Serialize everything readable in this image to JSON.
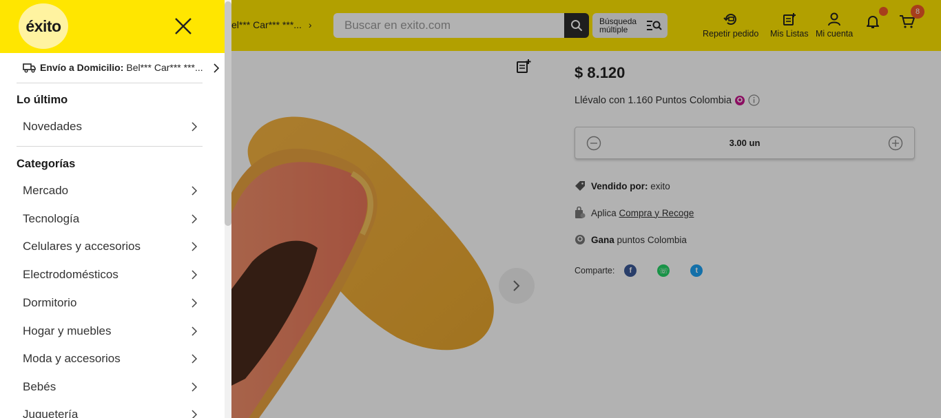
{
  "header": {
    "address_short": "el*** Car*** ***...",
    "search_placeholder": "Buscar en exito.com",
    "multi_search_label": "Búsqueda múltiple",
    "actions": {
      "repeat_order": "Repetir pedido",
      "my_lists": "Mis Listas",
      "my_account": "Mi cuenta"
    },
    "cart_count": "8"
  },
  "product": {
    "price": "$ 8.120",
    "points_prefix": "Llévalo con",
    "points_value": "1.160",
    "points_suffix": "Puntos Colombia",
    "quantity": "3.00 un",
    "seller_label": "Vendido por:",
    "seller_name": "exito",
    "pickup_prefix": "Aplica",
    "pickup_link": "Compra y Recoge",
    "earn_label": "Gana",
    "earn_text": "puntos Colombia",
    "share_label": "Comparte:"
  },
  "drawer": {
    "logo_text": "éxito",
    "delivery_label": "Envío a Domicilio:",
    "delivery_address": "Bel*** Car*** ***...",
    "latest_title": "Lo último",
    "latest_items": [
      "Novedades"
    ],
    "categories_title": "Categorías",
    "categories": [
      "Mercado",
      "Tecnología",
      "Celulares y accesorios",
      "Electrodomésticos",
      "Dormitorio",
      "Hogar y muebles",
      "Moda y accesorios",
      "Bebés",
      "Juguetería"
    ]
  },
  "colors": {
    "brand_yellow": "#ffe600",
    "badge_orange": "#f05a28",
    "facebook": "#3b5998",
    "whatsapp": "#25d366",
    "twitter": "#1da1f2"
  }
}
